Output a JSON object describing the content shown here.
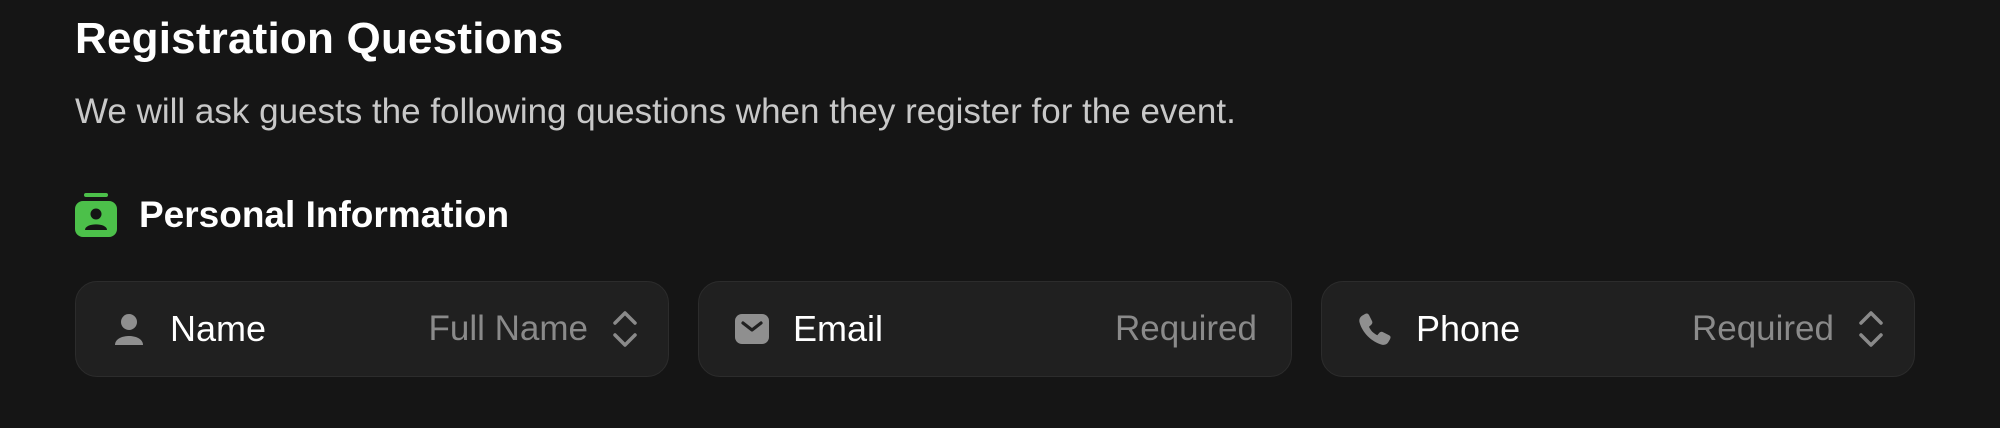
{
  "header": {
    "title": "Registration Questions",
    "subtitle": "We will ask guests the following questions when they register for the event."
  },
  "section": {
    "title": "Personal Information",
    "icon": "id-badge-icon",
    "accent_color": "#4cc04a"
  },
  "fields": [
    {
      "label": "Name",
      "value": "Full Name",
      "icon": "person-icon",
      "has_selector": true
    },
    {
      "label": "Email",
      "value": "Required",
      "icon": "envelope-icon",
      "has_selector": false
    },
    {
      "label": "Phone",
      "value": "Required",
      "icon": "phone-icon",
      "has_selector": true
    }
  ],
  "colors": {
    "background": "#151515",
    "card_background": "#202020",
    "muted_text": "#8a8a8a"
  }
}
